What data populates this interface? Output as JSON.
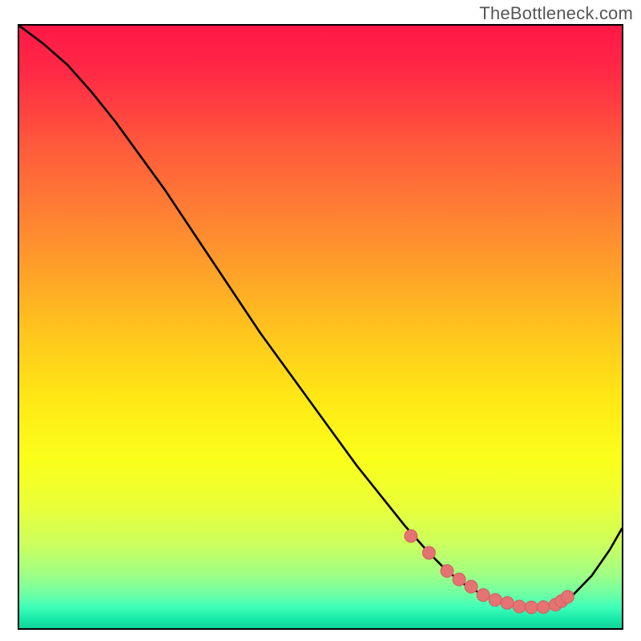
{
  "watermark": "TheBottleneck.com",
  "gradient_stops": [
    {
      "offset": 0.0,
      "color": "#ff1846"
    },
    {
      "offset": 0.08,
      "color": "#ff2a45"
    },
    {
      "offset": 0.2,
      "color": "#ff5a3c"
    },
    {
      "offset": 0.35,
      "color": "#ff8d30"
    },
    {
      "offset": 0.5,
      "color": "#ffc21e"
    },
    {
      "offset": 0.62,
      "color": "#ffe815"
    },
    {
      "offset": 0.72,
      "color": "#faff1a"
    },
    {
      "offset": 0.8,
      "color": "#e9ff3a"
    },
    {
      "offset": 0.86,
      "color": "#ccff5e"
    },
    {
      "offset": 0.91,
      "color": "#a1ff84"
    },
    {
      "offset": 0.945,
      "color": "#6bffa6"
    },
    {
      "offset": 0.965,
      "color": "#3effb9"
    },
    {
      "offset": 0.985,
      "color": "#18e9a8"
    },
    {
      "offset": 1.0,
      "color": "#10d49a"
    }
  ],
  "colors": {
    "curve": "#000000",
    "marker_fill": "#e57373",
    "marker_stroke": "#d46060"
  },
  "chart_data": {
    "type": "line",
    "title": "",
    "xlabel": "",
    "ylabel": "",
    "xlim": [
      0,
      100
    ],
    "ylim": [
      0,
      100
    ],
    "series": [
      {
        "name": "bottleneck-curve",
        "x": [
          0,
          4,
          8,
          12,
          16,
          20,
          24,
          28,
          32,
          36,
          40,
          44,
          48,
          52,
          56,
          60,
          64,
          68,
          71,
          74,
          77,
          80,
          83,
          86,
          89,
          92,
          95,
          98,
          100
        ],
        "y": [
          100,
          97,
          93.5,
          89,
          84,
          78.5,
          73,
          67,
          61,
          55,
          49,
          43.5,
          38,
          32.5,
          27,
          22,
          17,
          12.5,
          9.5,
          7.2,
          5.5,
          4.3,
          3.6,
          3.4,
          3.9,
          5.6,
          8.7,
          13.0,
          16.5
        ]
      }
    ],
    "markers": {
      "name": "highlight-points",
      "x": [
        65,
        68,
        71,
        73,
        75,
        77,
        79,
        81,
        83,
        85,
        87,
        89,
        90,
        91
      ],
      "y": [
        15.3,
        12.5,
        9.5,
        8.1,
        6.9,
        5.5,
        4.7,
        4.2,
        3.6,
        3.45,
        3.5,
        3.9,
        4.5,
        5.2
      ]
    }
  }
}
